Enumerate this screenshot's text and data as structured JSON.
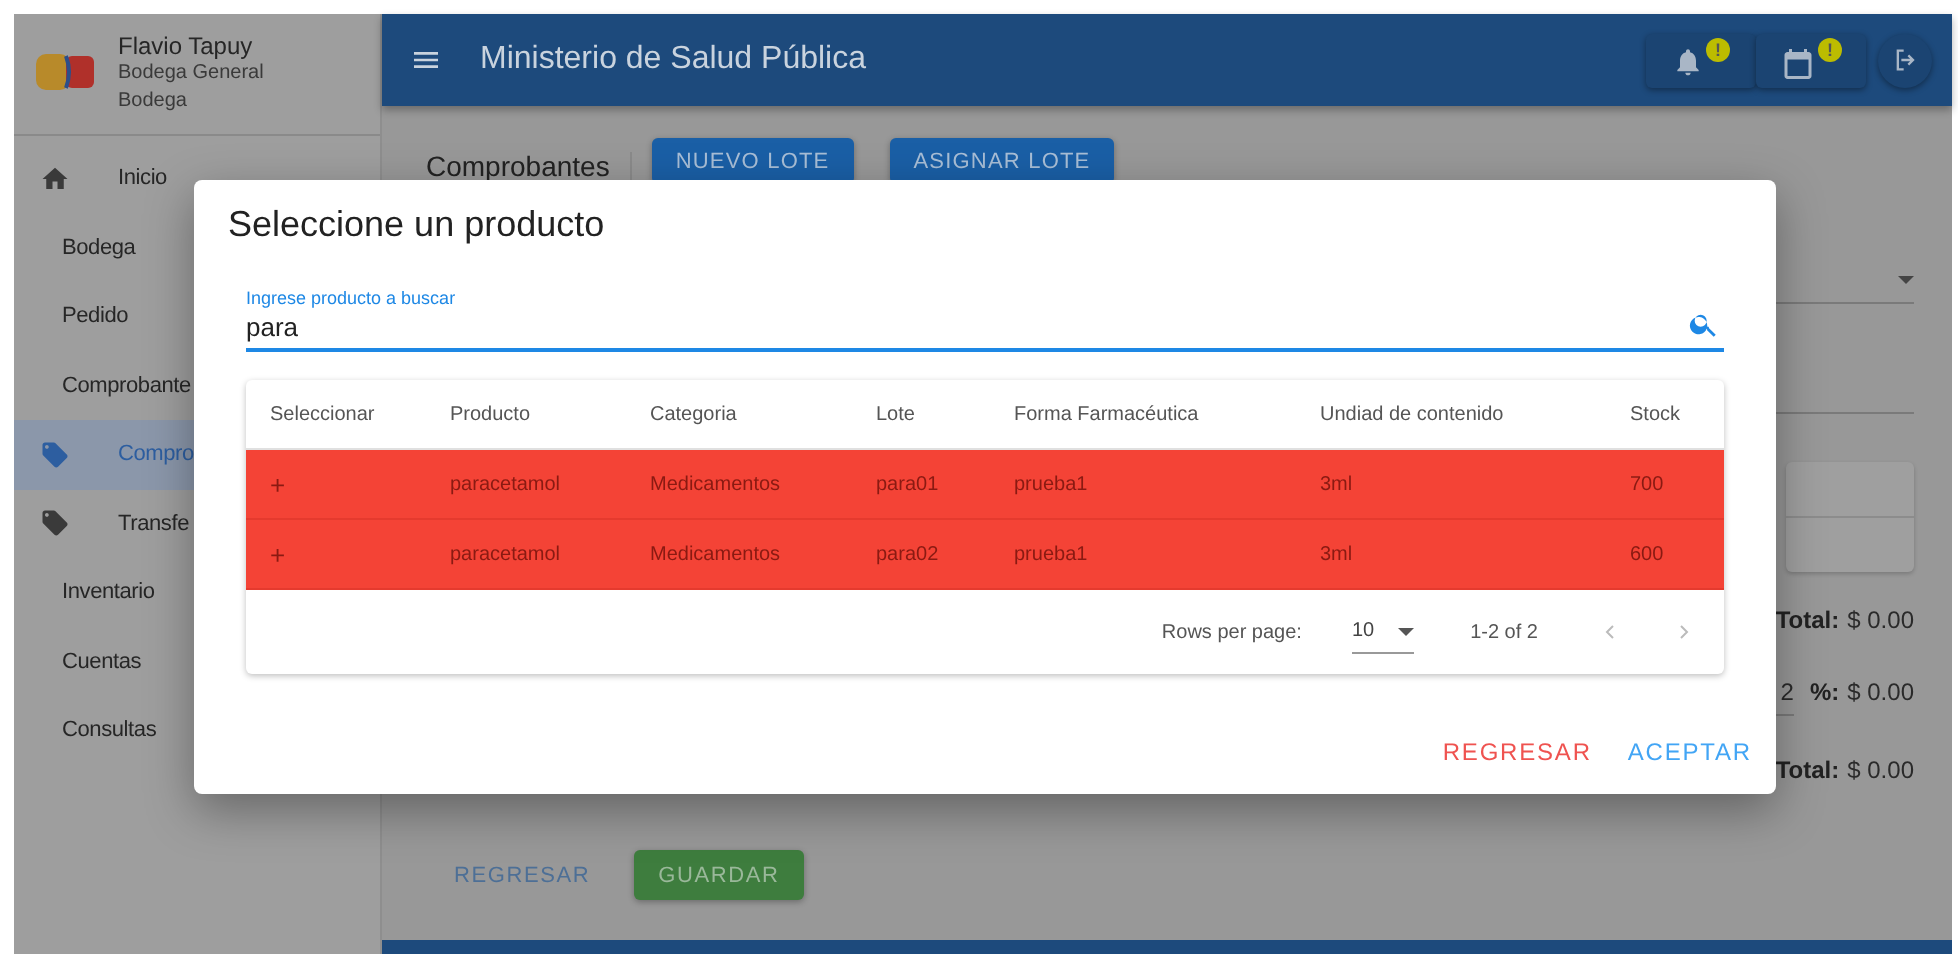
{
  "user": {
    "name": "Flavio Tapuy",
    "place": "Bodega General",
    "role": "Bodega"
  },
  "sidebar": {
    "items": [
      {
        "label": "Inicio",
        "kind": "home",
        "selected": false
      },
      {
        "label": "Bodega",
        "kind": "plain",
        "selected": false
      },
      {
        "label": "Pedido",
        "kind": "plain",
        "selected": false
      },
      {
        "label": "Comprobante",
        "kind": "plain",
        "selected": false
      },
      {
        "label": "Compro",
        "kind": "tag",
        "selected": true
      },
      {
        "label": "Transfe",
        "kind": "tag",
        "selected": false
      },
      {
        "label": "Inventario",
        "kind": "plain",
        "selected": false
      },
      {
        "label": "Cuentas",
        "kind": "plain",
        "selected": false
      },
      {
        "label": "Consultas",
        "kind": "plain",
        "selected": false
      }
    ]
  },
  "header": {
    "title": "Ministerio de Salud Pública",
    "badges": [
      {
        "kind": "bell",
        "badge": "!"
      },
      {
        "kind": "calendar",
        "badge": "!"
      }
    ]
  },
  "main": {
    "title": "Comprobantes",
    "buttons": [
      "NUEVO LOTE",
      "ASIGNAR LOTE"
    ],
    "totals": [
      {
        "label": "Total:",
        "value": "$ 0.00"
      },
      {
        "label": "%:",
        "value": "$ 0.00",
        "input": "2"
      },
      {
        "label": "Total:",
        "value": "$ 0.00"
      }
    ],
    "actions": [
      {
        "label": "REGRESAR",
        "kind": "text"
      },
      {
        "label": "GUARDAR",
        "kind": "filled"
      }
    ]
  },
  "dialog": {
    "title": "Seleccione un producto",
    "search": {
      "label": "Ingrese producto a buscar",
      "value": "para"
    },
    "table": {
      "columns": [
        "Seleccionar",
        "Producto",
        "Categoria",
        "Lote",
        "Forma Farmacéutica",
        "Undiad de contenido",
        "Stock"
      ],
      "rows": [
        {
          "cells": [
            "+",
            "paracetamol",
            "Medicamentos",
            "para01",
            "prueba1",
            "3ml",
            "700"
          ],
          "highlighted": true
        },
        {
          "cells": [
            "+",
            "paracetamol",
            "Medicamentos",
            "para02",
            "prueba1",
            "3ml",
            "600"
          ],
          "highlighted": true
        }
      ],
      "footer": {
        "rows_label": "Rows per page:",
        "rows_value": "10",
        "range": "1-2 of 2"
      }
    },
    "actions": [
      {
        "label": "REGRESAR",
        "kind": "cancel"
      },
      {
        "label": "ACEPTAR",
        "kind": "ok"
      }
    ]
  }
}
